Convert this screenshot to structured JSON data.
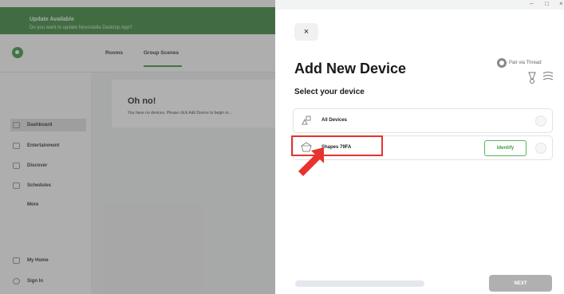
{
  "window": {
    "minimize_glyph": "–",
    "maximize_glyph": "□",
    "close_glyph": "×"
  },
  "app": {
    "update_banner": {
      "title": "Update Available",
      "subtitle": "Do you want to update Novostella Desktop App?"
    },
    "logo_icon": "app-logo-icon",
    "nav": {
      "rooms": "Rooms",
      "group_scenes": "Group Scenes"
    },
    "empty_state": {
      "title": "Oh no!",
      "message": "You have no devices. Please click Add Device to begin or..."
    },
    "sidebar": {
      "items": [
        {
          "label": "Dashboard",
          "icon": "dashboard-icon",
          "active": true
        },
        {
          "label": "Entertainment",
          "icon": "entertainment-icon",
          "active": false
        },
        {
          "label": "Discover",
          "icon": "discover-icon",
          "active": false
        },
        {
          "label": "Schedules",
          "icon": "schedules-icon",
          "active": false
        },
        {
          "label": "More",
          "icon": "more-icon",
          "active": false
        }
      ],
      "footer": [
        {
          "label": "My Home",
          "icon": "home-icon"
        },
        {
          "label": "Sign In",
          "icon": "user-icon"
        }
      ]
    }
  },
  "dialog": {
    "close_label": "×",
    "title": "Add New Device",
    "subtitle": "Select your device",
    "pair_via_thread": "Pair via Thread",
    "devices": [
      {
        "label": "All Devices",
        "icon": "devices-icon"
      },
      {
        "label": "Shapes 79FA",
        "icon": "shapes-icon",
        "identify_label": "Identify"
      }
    ],
    "progress": 0.0,
    "next_label": "NEXT"
  },
  "colors": {
    "brand_green": "#2f8a35",
    "annotation_red": "#e8322f",
    "identify_green": "#3f9d45"
  }
}
